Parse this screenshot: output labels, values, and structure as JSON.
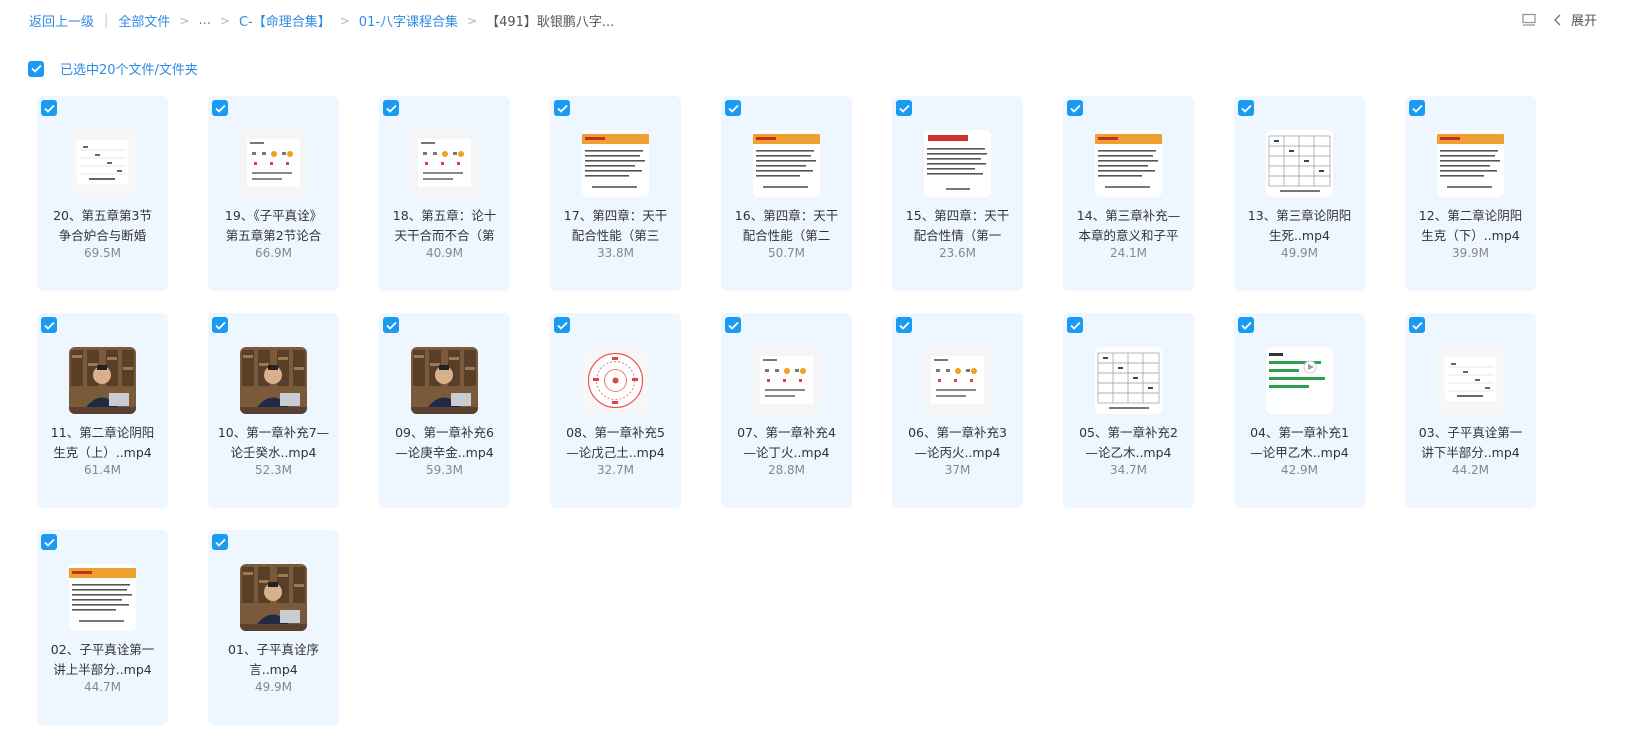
{
  "breadcrumb": {
    "back": "返回上一级",
    "all_files": "全部文件",
    "ellipsis": "...",
    "folder1": "C-【命理合集】",
    "folder2": "01-八字课程合集",
    "current": "【491】耿银鹏八字..."
  },
  "toolbar": {
    "expand_label": "展开"
  },
  "selection": {
    "text": "已选中20个文件/文件夹"
  },
  "colors": {
    "accent": "#2f8ae6",
    "checkbox": "#1a9af0",
    "card_bg": "#eef7ff"
  },
  "files": [
    {
      "line1": "20、第五章第3节",
      "line2": "争合妒合与断婚",
      "size": "69.5M",
      "thumb": "doc-table"
    },
    {
      "line1": "19、《子平真诠》",
      "line2": "第五章第2节论合",
      "size": "66.9M",
      "thumb": "doc-chart"
    },
    {
      "line1": "18、第五章：论十",
      "line2": "天干合而不合（第",
      "size": "40.9M",
      "thumb": "doc-chart"
    },
    {
      "line1": "17、第四章：天干",
      "line2": "配合性能（第三",
      "size": "33.8M",
      "thumb": "doc-orange"
    },
    {
      "line1": "16、第四章：天干",
      "line2": "配合性能（第二",
      "size": "50.7M",
      "thumb": "doc-orange"
    },
    {
      "line1": "15、第四章：天干",
      "line2": "配合性情（第一",
      "size": "23.6M",
      "thumb": "doc-red"
    },
    {
      "line1": "14、第三章补充—",
      "line2": "本章的意义和子平",
      "size": "24.1M",
      "thumb": "doc-orange"
    },
    {
      "line1": "13、第三章论阴阳",
      "line2": "生死..mp4",
      "size": "49.9M",
      "thumb": "doc-grid"
    },
    {
      "line1": "12、第二章论阴阳",
      "line2": "生克（下）..mp4",
      "size": "39.9M",
      "thumb": "doc-orange"
    },
    {
      "line1": "11、第二章论阴阳",
      "line2": "生克（上）..mp4",
      "size": "61.4M",
      "thumb": "video"
    },
    {
      "line1": "10、第一章补充7—",
      "line2": "论壬癸水..mp4",
      "size": "52.3M",
      "thumb": "video"
    },
    {
      "line1": "09、第一章补充6",
      "line2": "—论庚辛金..mp4",
      "size": "59.3M",
      "thumb": "video"
    },
    {
      "line1": "08、第一章补充5",
      "line2": "—论戊己土..mp4",
      "size": "32.7M",
      "thumb": "wheel"
    },
    {
      "line1": "07、第一章补充4",
      "line2": "—论丁火..mp4",
      "size": "28.8M",
      "thumb": "doc-chart"
    },
    {
      "line1": "06、第一章补充3",
      "line2": "—论丙火..mp4",
      "size": "37M",
      "thumb": "doc-chart"
    },
    {
      "line1": "05、第一章补充2",
      "line2": "—论乙木..mp4",
      "size": "34.7M",
      "thumb": "doc-grid"
    },
    {
      "line1": "04、第一章补充1",
      "line2": "—论甲乙木..mp4",
      "size": "42.9M",
      "thumb": "doc-green"
    },
    {
      "line1": "03、子平真诠第一",
      "line2": "讲下半部分..mp4",
      "size": "44.2M",
      "thumb": "doc-table"
    },
    {
      "line1": "02、子平真诠第一",
      "line2": "讲上半部分..mp4",
      "size": "44.7M",
      "thumb": "doc-orange"
    },
    {
      "line1": "01、子平真诠序",
      "line2": "言..mp4",
      "size": "49.9M",
      "thumb": "video"
    }
  ]
}
